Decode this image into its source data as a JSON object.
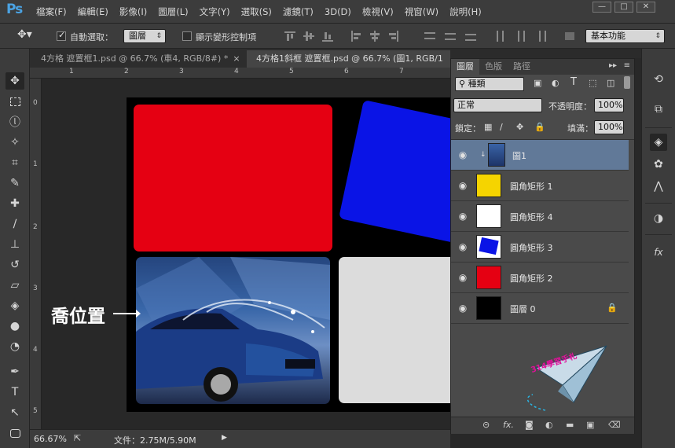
{
  "app": {
    "logo": "Ps"
  },
  "menu": [
    "檔案(F)",
    "編輯(E)",
    "影像(I)",
    "圖層(L)",
    "文字(Y)",
    "選取(S)",
    "濾鏡(T)",
    "3D(D)",
    "檢視(V)",
    "視窗(W)",
    "說明(H)"
  ],
  "window_controls": {
    "minimize": "—",
    "maximize": "□",
    "close": "✕"
  },
  "options_bar": {
    "auto_select_label": "自動選取：",
    "auto_select_checked": true,
    "auto_select_target": "圖層",
    "show_transform_label": "顯示變形控制項",
    "show_transform_checked": false,
    "workspace": "基本功能"
  },
  "tabs": [
    {
      "label": "4方格 遮置框1.psd @ 66.7% (車4, RGB/8#) *",
      "close": "×",
      "active": false
    },
    {
      "label": "4方格1斜框 遮置框.psd @ 66.7% (圖1, RGB/1",
      "close": "",
      "active": true
    }
  ],
  "ruler": {
    "h_labels": [
      "1",
      "2",
      "3",
      "4",
      "5",
      "6",
      "7"
    ],
    "v_labels": [
      "0",
      "1",
      "2",
      "3",
      "4",
      "5"
    ]
  },
  "canvas": {
    "annotation": "喬位置",
    "colors": {
      "red": "#e50012",
      "blue": "#0a14e6",
      "gray": "#dcdcdc",
      "black": "#000000"
    }
  },
  "status": {
    "zoom": "66.67%",
    "file_info": "文件：2.75M/5.90M"
  },
  "layers_panel": {
    "tabs": [
      "圖層",
      "色版",
      "路徑"
    ],
    "filter_kind": "種類",
    "blend_mode": "正常",
    "opacity_label": "不透明度：",
    "opacity_value": "100%",
    "lock_label": "鎖定：",
    "fill_label": "填滿：",
    "fill_value": "100%",
    "layers": [
      {
        "name": "圖1",
        "thumb": "photo",
        "selected": true,
        "locked": false
      },
      {
        "name": "圓角矩形 1",
        "thumb": "#f5d400",
        "selected": false,
        "locked": false
      },
      {
        "name": "圓角矩形 4",
        "thumb": "#ffffff",
        "selected": false,
        "locked": false
      },
      {
        "name": "圓角矩形 3",
        "thumb": "#0a14e6",
        "selected": false,
        "locked": false
      },
      {
        "name": "圓角矩形 2",
        "thumb": "#e50012",
        "selected": false,
        "locked": false
      },
      {
        "name": "圖層 0",
        "thumb": "#000000",
        "selected": false,
        "locked": true
      }
    ],
    "bottom_icons": [
      "link-icon",
      "fx-icon",
      "mask-icon",
      "adjustment-icon",
      "folder-icon",
      "new-layer-icon",
      "trash-icon"
    ]
  },
  "decoration_text": "314學習手札"
}
